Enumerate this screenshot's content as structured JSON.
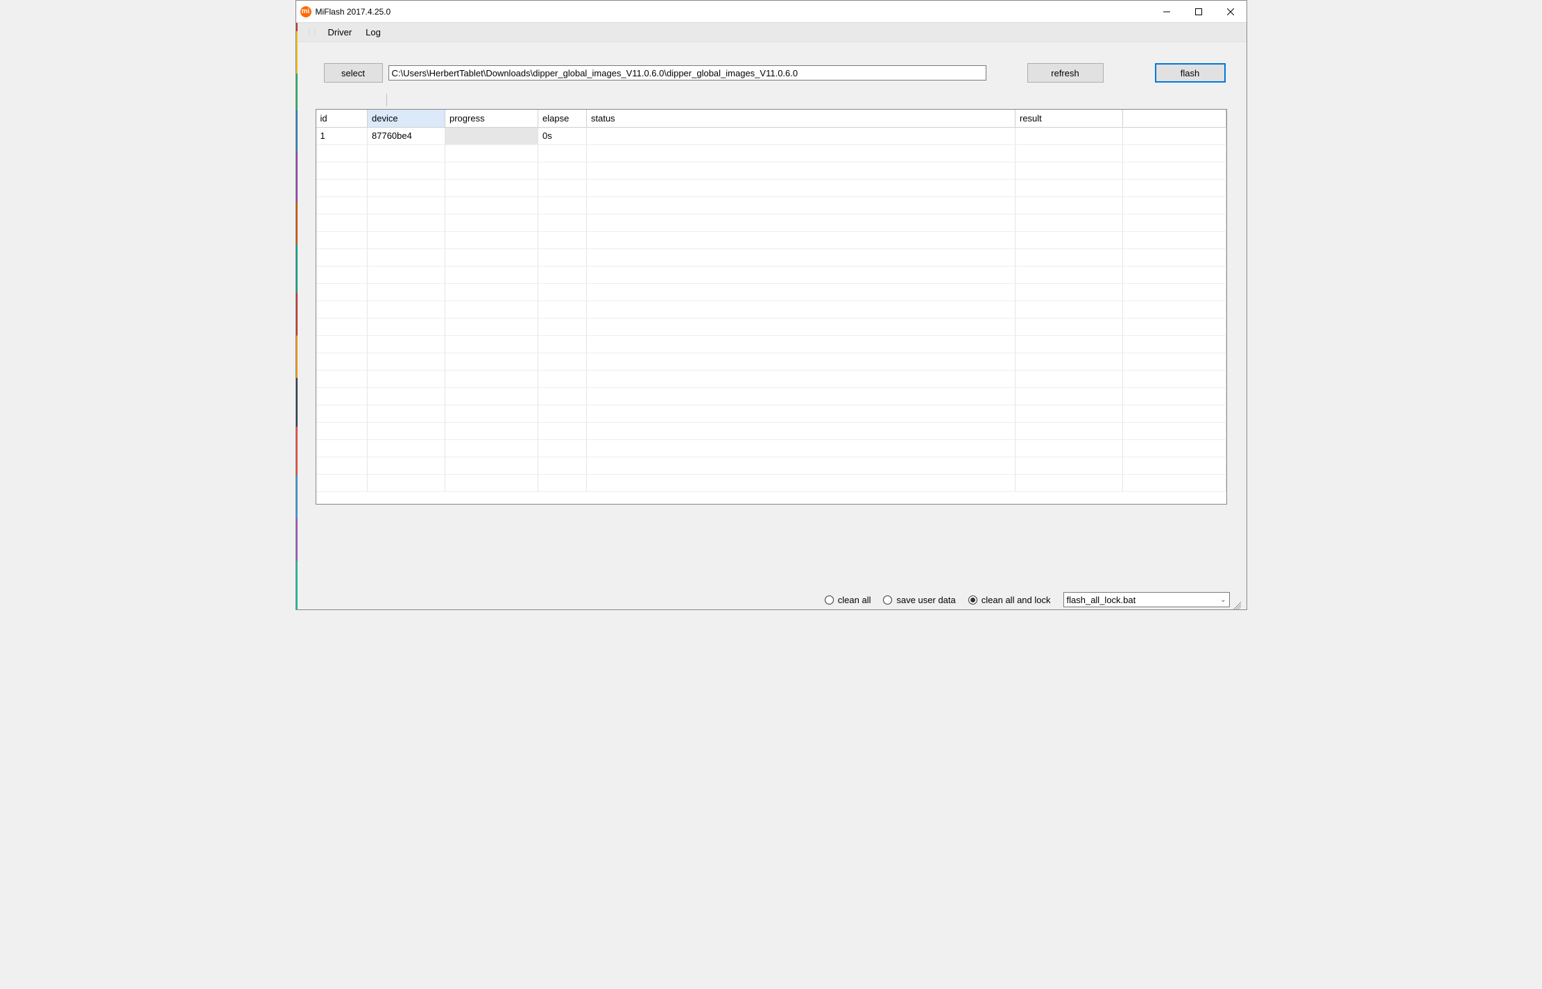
{
  "window": {
    "title": "MiFlash 2017.4.25.0",
    "icon_letter": "mi"
  },
  "menubar": {
    "items": [
      "Driver",
      "Log"
    ]
  },
  "toolbar": {
    "select_label": "select",
    "path_value": "C:\\Users\\HerbertTablet\\Downloads\\dipper_global_images_V11.0.6.0\\dipper_global_images_V11.0.6.0",
    "refresh_label": "refresh",
    "flash_label": "flash"
  },
  "grid": {
    "columns": [
      "id",
      "device",
      "progress",
      "elapse",
      "status",
      "result",
      ""
    ],
    "selected_column_index": 1,
    "rows": [
      {
        "id": "1",
        "device": "87760be4",
        "elapse": "0s",
        "status": "",
        "result": ""
      }
    ],
    "empty_row_count": 20
  },
  "footer": {
    "options": [
      {
        "label": "clean all",
        "checked": false
      },
      {
        "label": "save user data",
        "checked": false
      },
      {
        "label": "clean all and lock",
        "checked": true
      }
    ],
    "script": "flash_all_lock.bat"
  }
}
